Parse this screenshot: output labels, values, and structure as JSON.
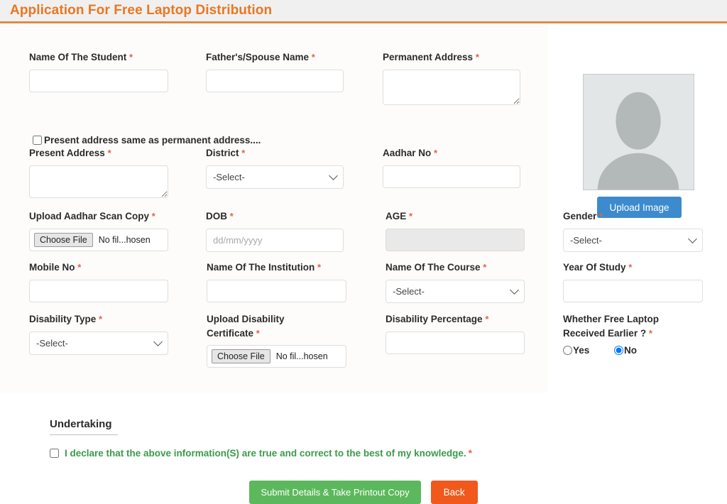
{
  "header": {
    "title": "Application For Free Laptop Distribution",
    "accent_color": "#e87722",
    "band_color": "#f0f0f0"
  },
  "required_marker": "*",
  "fields": {
    "student_name": {
      "label": "Name Of The Student",
      "value": "",
      "required": true
    },
    "father_spouse_name": {
      "label": "Father's/Spouse Name",
      "value": "",
      "required": true
    },
    "permanent_address": {
      "label": "Permanent Address",
      "value": "",
      "required": true
    },
    "same_address_checkbox": {
      "label": "Present address same as permanent address....",
      "checked": false
    },
    "present_address": {
      "label": "Present Address",
      "value": "",
      "required": true
    },
    "district": {
      "label": "District",
      "selected": "-Select-",
      "options": [
        "-Select-"
      ],
      "required": true
    },
    "aadhar_no": {
      "label": "Aadhar No",
      "value": "",
      "required": true
    },
    "upload_aadhar": {
      "label": "Upload Aadhar Scan Copy",
      "button_label": "Choose File",
      "file_status": "No fil...hosen",
      "required": true
    },
    "dob": {
      "label": "DOB",
      "value": "",
      "placeholder": "dd/mm/yyyy",
      "required": true
    },
    "age": {
      "label": "AGE",
      "value": "",
      "required": true,
      "disabled": true
    },
    "gender": {
      "label": "Gender",
      "selected": "-Select-",
      "options": [
        "-Select-"
      ],
      "required": true
    },
    "mobile_no": {
      "label": "Mobile No",
      "value": "",
      "required": true
    },
    "institution_name": {
      "label": "Name Of The Institution",
      "value": "",
      "required": true
    },
    "course_name": {
      "label": "Name Of The Course",
      "selected": "-Select-",
      "options": [
        "-Select-"
      ],
      "required": true
    },
    "year_of_study": {
      "label": "Year Of Study",
      "value": "",
      "required": true
    },
    "disability_type": {
      "label": "Disability Type",
      "selected": "-Select-",
      "options": [
        "-Select-"
      ],
      "required": true
    },
    "upload_disability_certificate": {
      "label_line1": "Upload Disability",
      "label_line2": "Certificate",
      "button_label": "Choose File",
      "file_status": "No fil...hosen",
      "required": true
    },
    "disability_percentage": {
      "label": "Disability Percentage",
      "value": "",
      "required": true
    },
    "laptop_received_earlier": {
      "label_line1": "Whether Free Laptop",
      "label_line2": "Received Earlier ?",
      "required": true,
      "options": [
        {
          "label": "Yes",
          "value": "yes",
          "selected": false
        },
        {
          "label": "No",
          "value": "no",
          "selected": true
        }
      ]
    }
  },
  "photo": {
    "icon": "user-placeholder-icon",
    "upload_button_label": "Upload Image",
    "upload_button_color": "#3d8bcd"
  },
  "undertaking": {
    "heading": "Undertaking",
    "declaration_text": "I declare that the above information(S) are true and correct to the best of my knowledge.",
    "declaration_required": "*",
    "declaration_color": "#3a9b4a",
    "checked": false
  },
  "actions": {
    "submit_label": "Submit Details & Take Printout Copy",
    "submit_color": "#5cb85c",
    "back_label": "Back",
    "back_color": "#f1581c"
  }
}
